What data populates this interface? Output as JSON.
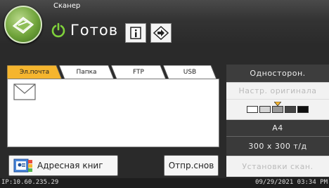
{
  "header": {
    "app_label": "Сканер",
    "status": "Готов",
    "app_icon": "scanner-app-icon",
    "status_icon": "power-ready-icon"
  },
  "tabs": [
    {
      "label": "Эл.почта",
      "active": true
    },
    {
      "label": "Папка",
      "active": false
    },
    {
      "label": "FTP",
      "active": false
    },
    {
      "label": "USB",
      "active": false
    }
  ],
  "main": {
    "destination_icon": "envelope-icon"
  },
  "buttons": {
    "address_book": "Адресная книг",
    "send_files": "Отпр.снов"
  },
  "settings": {
    "sides": "Односторон.",
    "original_settings": "Настр. оригинала",
    "paper_size": "A4",
    "resolution": "300 x 300 т/д",
    "scan_settings": "Установки скан."
  },
  "density": {
    "levels": 5,
    "selected": 3
  },
  "footer": {
    "ip": "IP:10.60.235.29",
    "datetime": "09/29/2021 03:34 PM"
  },
  "colors": {
    "active_tab": "#f5b52e",
    "header_bg": "#333333",
    "panel_dark": "#3a3a3a"
  }
}
